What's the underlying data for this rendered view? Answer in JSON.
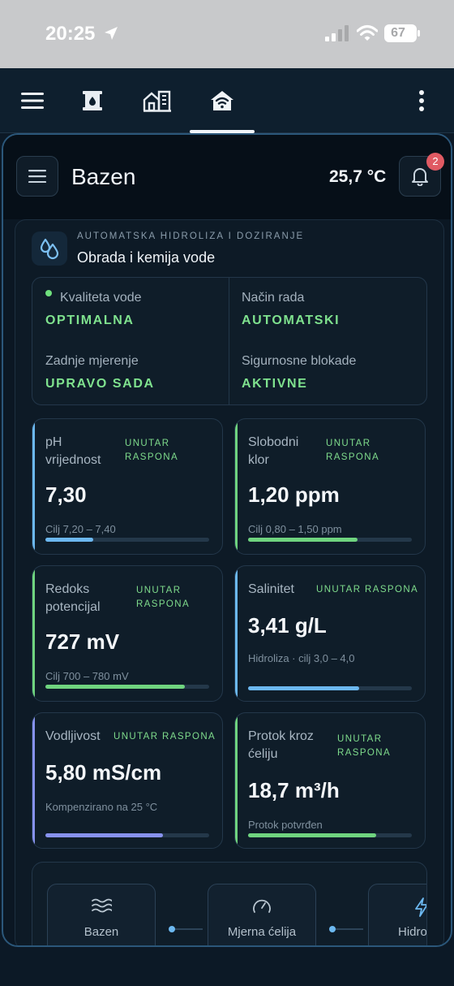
{
  "status_bar": {
    "time": "20:25",
    "battery": "67"
  },
  "header": {
    "title": "Bazen",
    "temperature": "25,7 °C",
    "notification_count": "2"
  },
  "section": {
    "kicker": "AUTOMATSKA HIDROLIZA I DOZIRANJE",
    "title": "Obrada i kemija vode"
  },
  "status": {
    "water_quality_label": "Kvaliteta vode",
    "water_quality_value": "OPTIMALNA",
    "mode_label": "Način rada",
    "mode_value": "AUTOMATSKI",
    "last_measure_label": "Zadnje mjerenje",
    "last_measure_value": "UPRAVO SADA",
    "safety_label": "Sigurnosne blokade",
    "safety_value": "AKTIVNE"
  },
  "metrics": [
    {
      "name_line1": "pH",
      "name_line2": "vrijednost",
      "badge_line1": "UNUTAR",
      "badge_line2": "RASPONA",
      "value": "7,30",
      "sub": "Cilj 7,20 – 7,40",
      "fill": 0.29,
      "color": "#6cb8f0"
    },
    {
      "name_line1": "Slobodni",
      "name_line2": "klor",
      "badge_line1": "UNUTAR",
      "badge_line2": "RASPONA",
      "value": "1,20 ppm",
      "sub": "Cilj 0,80 – 1,50 ppm",
      "fill": 0.67,
      "color": "#6fd47f"
    },
    {
      "name_line1": "Redoks",
      "name_line2": "potencijal",
      "badge_line1": "UNUTAR",
      "badge_line2": "RASPONA",
      "value": "727 mV",
      "sub": "Cilj 700 – 780 mV",
      "fill": 0.85,
      "color": "#6fd47f"
    },
    {
      "name_line1": "Salinitet",
      "badge_line1": "UNUTAR RASPONA",
      "value": "3,41 g/L",
      "sub": "Hidroliza · cilj 3,0 – 4,0",
      "fill": 0.68,
      "color": "#6cb8f0"
    },
    {
      "name_line1": "Vodljivost",
      "badge_line1": "UNUTAR RASPONA",
      "value": "5,80 mS/cm",
      "sub": "Kompenzirano na 25 °C",
      "fill": 0.72,
      "color": "#8792ee"
    },
    {
      "name_line1": "Protok kroz",
      "name_line2": "ćeliju",
      "badge_line1": "UNUTAR",
      "badge_line2": "RASPONA",
      "value": "18,7 m³/h",
      "sub": "Protok potvrđen",
      "fill": 0.78,
      "color": "#6fd47f"
    }
  ],
  "flow": [
    {
      "label": "Bazen",
      "icon": "waves-icon"
    },
    {
      "label": "Mjerna ćelija",
      "icon": "gauge-icon"
    },
    {
      "label": "Hidro",
      "icon": "lightning-icon"
    }
  ],
  "icons": [
    "location-arrow-icon",
    "signal-icon",
    "wifi-icon",
    "menu-icon",
    "water-tank-icon",
    "building-icon",
    "home-wifi-icon",
    "more-icon",
    "bell-icon",
    "water-drops-icon"
  ]
}
